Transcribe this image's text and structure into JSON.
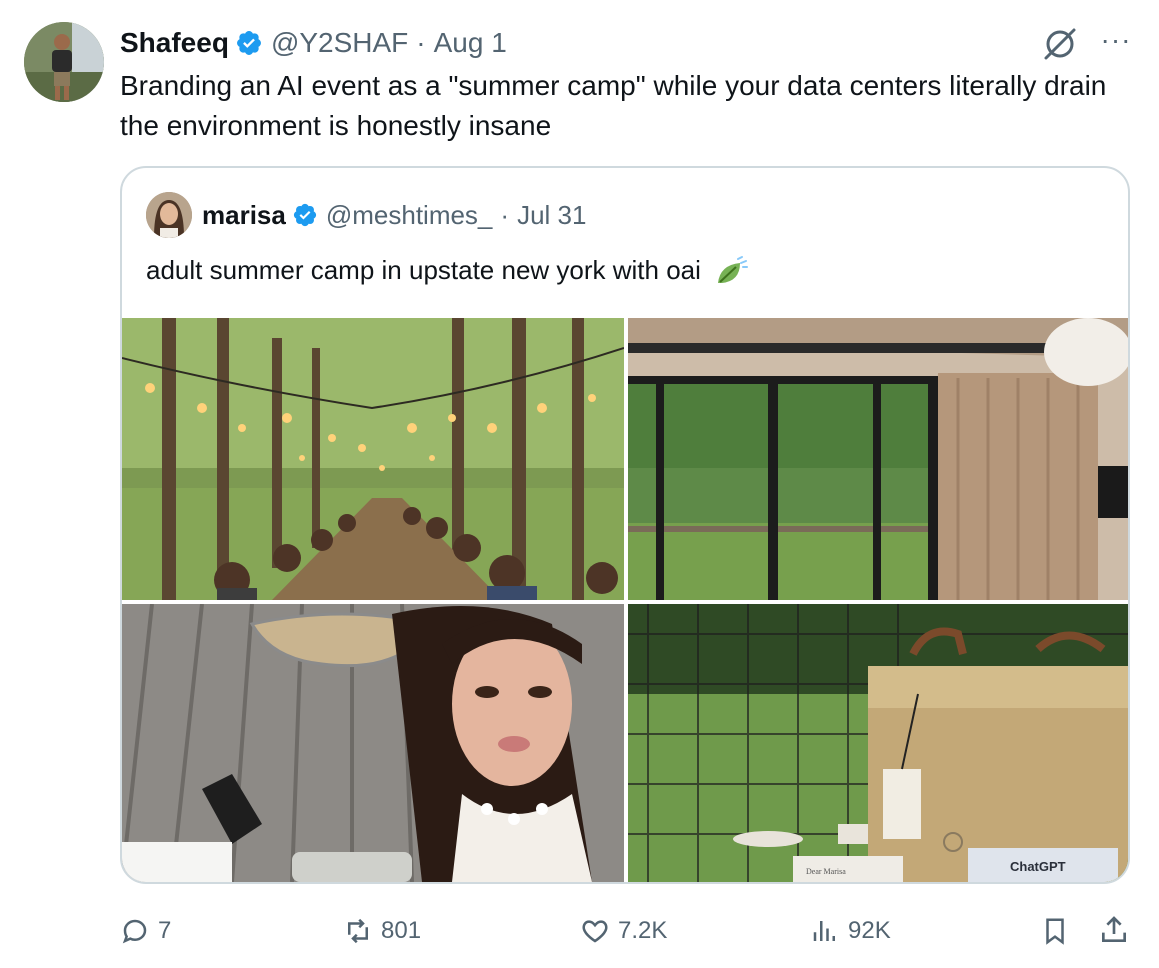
{
  "tweet": {
    "author_name": "Shafeeq",
    "handle": "@Y2SHAF",
    "separator": "·",
    "date": "Aug 1",
    "text": "Branding an AI event as a \"summer camp\" while your data centers literally drain the environment is honestly insane",
    "more_label": "···"
  },
  "quote": {
    "author_name": "marisa",
    "handle": "@meshtimes_",
    "separator": "·",
    "date": "Jul 31",
    "text": "adult summer camp in upstate new york with oai",
    "photos": [
      {
        "icon": "long-dinner-table-photo"
      },
      {
        "icon": "cabin-window-photo"
      },
      {
        "icon": "selfie-photo"
      },
      {
        "icon": "tote-bag-photo",
        "card_text": "ChatGPT",
        "note_text": "Dear Marisa"
      }
    ]
  },
  "actions": {
    "replies": "7",
    "reposts": "801",
    "likes": "7.2K",
    "views": "92K"
  },
  "colors": {
    "verified": "#1d9bf0",
    "secondary_text": "#536471",
    "border": "#cfd9de"
  }
}
